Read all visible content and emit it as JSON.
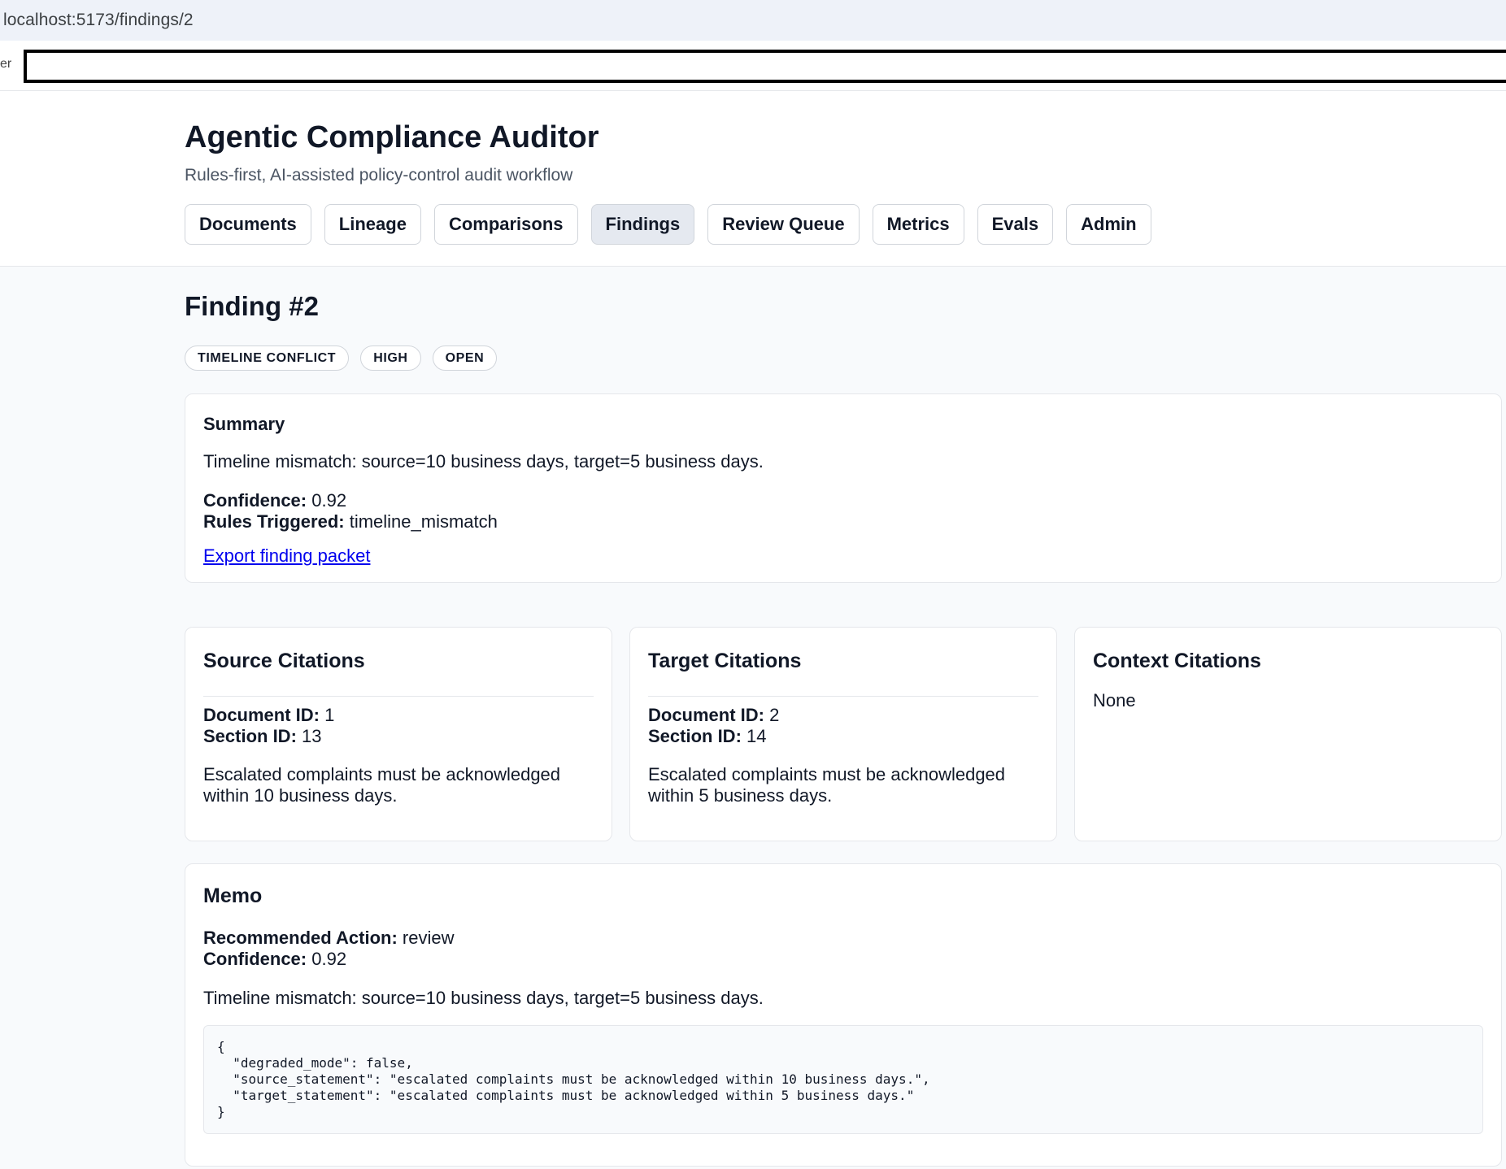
{
  "browser": {
    "url": "localhost:5173/findings/2",
    "search_label": "er"
  },
  "app": {
    "title": "Agentic Compliance Auditor",
    "subtitle": "Rules-first, AI-assisted policy-control audit workflow"
  },
  "nav": {
    "documents": "Documents",
    "lineage": "Lineage",
    "comparisons": "Comparisons",
    "findings": "Findings",
    "review_queue": "Review Queue",
    "metrics": "Metrics",
    "evals": "Evals",
    "admin": "Admin",
    "active": "Findings"
  },
  "finding": {
    "title": "Finding #2",
    "badges": {
      "type": "TIMELINE CONFLICT",
      "severity": "HIGH",
      "status": "OPEN"
    }
  },
  "summary": {
    "heading": "Summary",
    "text": "Timeline mismatch: source=10 business days, target=5 business days.",
    "confidence_label": "Confidence:",
    "confidence_value": "0.92",
    "rules_label": "Rules Triggered:",
    "rules_value": "timeline_mismatch",
    "export_link": "Export finding packet"
  },
  "source_citations": {
    "heading": "Source Citations",
    "document_label": "Document ID:",
    "document_value": "1",
    "section_label": "Section ID:",
    "section_value": "13",
    "text": "Escalated complaints must be acknowledged within 10 business days."
  },
  "target_citations": {
    "heading": "Target Citations",
    "document_label": "Document ID:",
    "document_value": "2",
    "section_label": "Section ID:",
    "section_value": "14",
    "text": "Escalated complaints must be acknowledged within 5 business days."
  },
  "context_citations": {
    "heading": "Context Citations",
    "text": "None"
  },
  "memo": {
    "heading": "Memo",
    "action_label": "Recommended Action:",
    "action_value": "review",
    "confidence_label": "Confidence:",
    "confidence_value": "0.92",
    "text": "Timeline mismatch: source=10 business days, target=5 business days.",
    "json": "{\n  \"degraded_mode\": false,\n  \"source_statement\": \"escalated complaints must be acknowledged within 10 business days.\",\n  \"target_statement\": \"escalated complaints must be acknowledged within 5 business days.\"\n}"
  }
}
